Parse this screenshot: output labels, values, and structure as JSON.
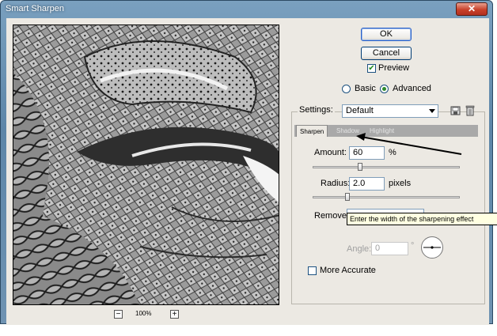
{
  "window": {
    "title": "Smart Sharpen",
    "close_glyph": "✕"
  },
  "preview": {
    "zoom": "100%",
    "zoom_out": "−",
    "zoom_in": "+"
  },
  "buttons": {
    "ok": "OK",
    "cancel": "Cancel"
  },
  "preview_toggle": {
    "label": "Preview",
    "checked": true
  },
  "mode": {
    "basic": "Basic",
    "advanced": "Advanced",
    "selected": "Advanced"
  },
  "settings": {
    "label": "Settings:",
    "value": "Default",
    "save_icon": "save-icon",
    "delete_icon": "trash-icon"
  },
  "tabs": [
    {
      "label": "Sharpen",
      "active": true
    },
    {
      "label": "Shadow",
      "active": false
    },
    {
      "label": "Highlight",
      "active": false
    }
  ],
  "amount": {
    "label": "Amount:",
    "value": "60",
    "unit": "%"
  },
  "radius": {
    "label": "Radius:",
    "value": "2.0",
    "unit": "pixels"
  },
  "remove": {
    "label": "Remove:"
  },
  "tooltip": "Enter the width of the sharpening effect",
  "angle": {
    "label": "Angle:",
    "value": "0",
    "unit": "°"
  },
  "more_accurate": {
    "label": "More Accurate",
    "checked": false
  },
  "colors": {
    "accent": "#2d8a2d",
    "titlebar": "#5d86a8",
    "close": "#c8412a"
  }
}
